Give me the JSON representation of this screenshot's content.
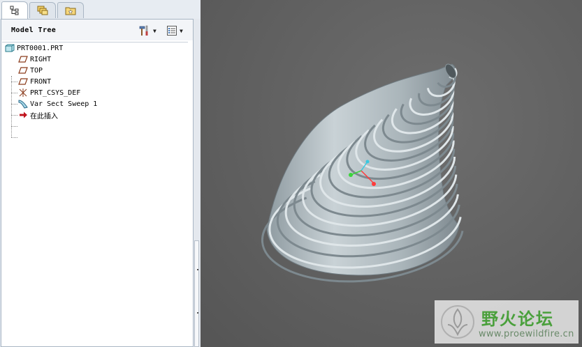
{
  "tabs": [
    {
      "name": "model-tree",
      "icon": "model-tree-icon",
      "active": true
    },
    {
      "name": "layers",
      "icon": "layers-icon",
      "active": false
    },
    {
      "name": "favorites",
      "icon": "folder-star-icon",
      "active": false
    }
  ],
  "tree_panel": {
    "title": "Model Tree",
    "settings_icon": "tools-icon",
    "show_icon": "list-icon"
  },
  "tree": [
    {
      "label": "PRT0001.PRT",
      "icon": "part-icon"
    },
    {
      "label": "RIGHT",
      "icon": "datum-plane-icon"
    },
    {
      "label": "TOP",
      "icon": "datum-plane-icon"
    },
    {
      "label": "FRONT",
      "icon": "datum-plane-icon"
    },
    {
      "label": "PRT_CSYS_DEF",
      "icon": "csys-icon"
    },
    {
      "label": "Var Sect Sweep 1",
      "icon": "sweep-icon"
    },
    {
      "label": "在此插入",
      "icon": "insert-arrow-icon"
    }
  ],
  "watermark": {
    "title": "野火论坛",
    "url": "www.proewildfire.cn",
    "colors": {
      "title": "#4aa03c",
      "url": "#6a8a6a"
    }
  },
  "viewport": {
    "background": "#626262",
    "model_color": "#b8c3c8",
    "triad_colors": {
      "x": "#ff3b3b",
      "y": "#3bd43b",
      "z": "#37c8e0"
    }
  }
}
